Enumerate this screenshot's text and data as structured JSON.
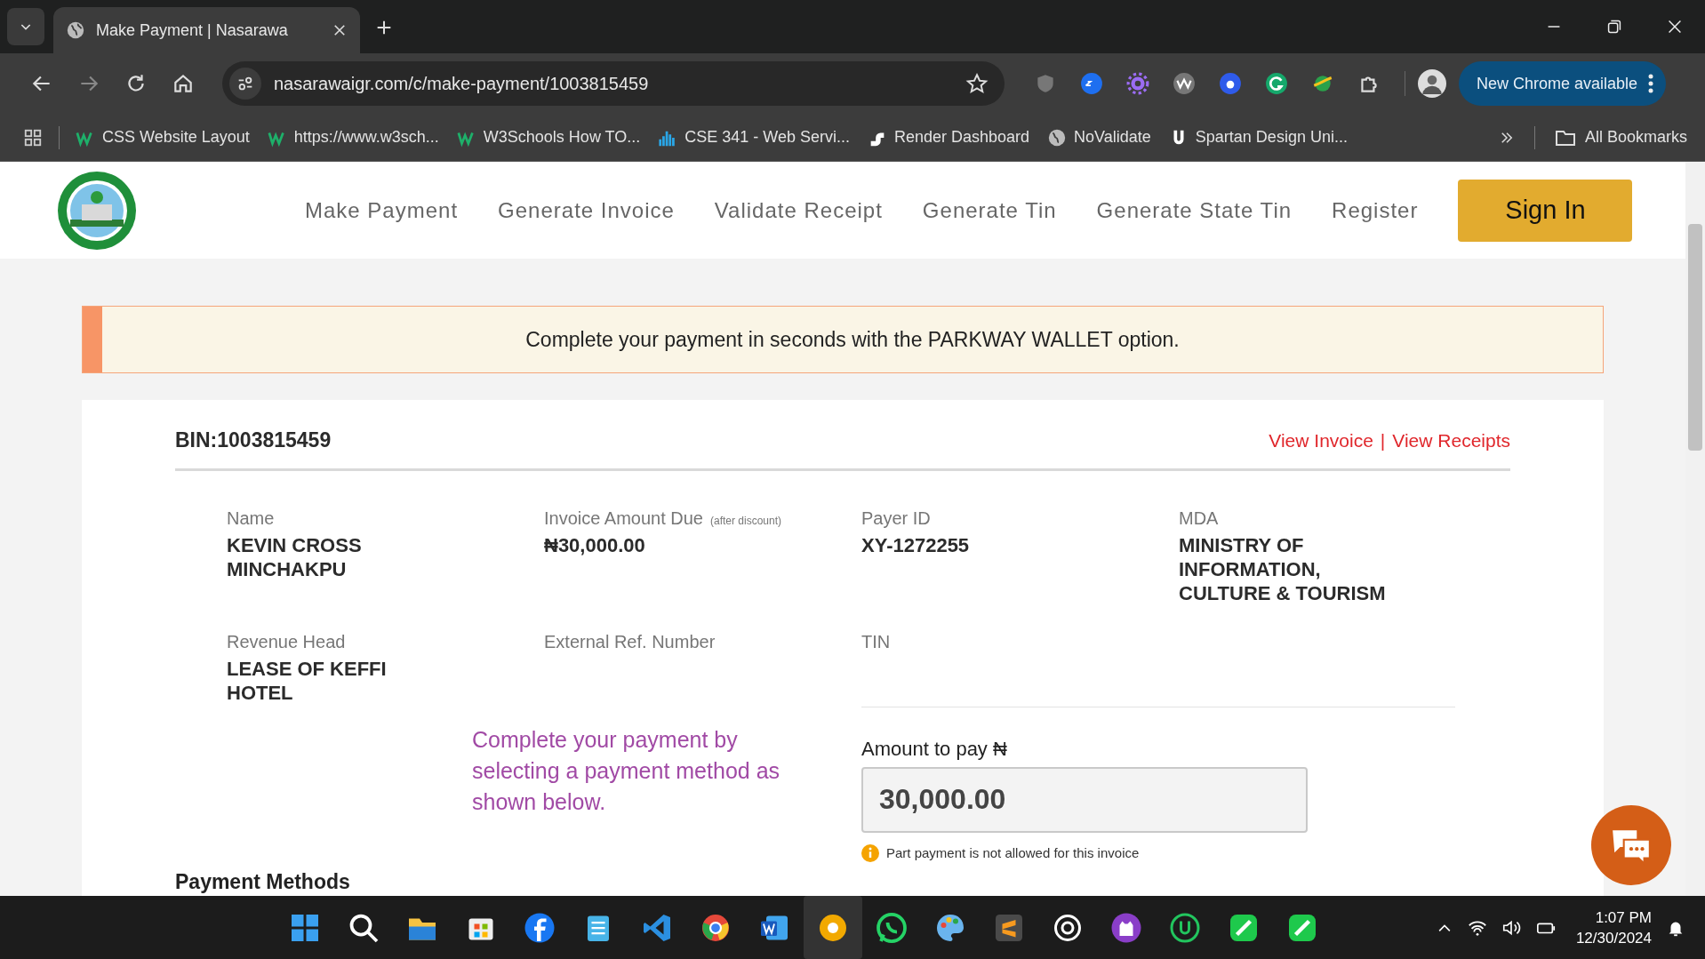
{
  "browser": {
    "tabs": [
      {
        "title": "Make Payment | Nasarawa",
        "selected": true
      }
    ],
    "url": "nasarawaigr.com/c/make-payment/1003815459",
    "update_button": "New Chrome available",
    "bookmarks": [
      {
        "label": "CSS Website Layout",
        "kind": "w3"
      },
      {
        "label": "https://www.w3sch...",
        "kind": "w3"
      },
      {
        "label": "W3Schools How TO...",
        "kind": "w3"
      },
      {
        "label": "CSE 341 - Web Servi...",
        "kind": "bars"
      },
      {
        "label": "Render Dashboard",
        "kind": "render"
      },
      {
        "label": "NoValidate",
        "kind": "globe"
      },
      {
        "label": "Spartan Design Uni...",
        "kind": "u"
      }
    ],
    "all_bookmarks": "All Bookmarks"
  },
  "site": {
    "nav": [
      "Make Payment",
      "Generate Invoice",
      "Validate Receipt",
      "Generate Tin",
      "Generate State Tin",
      "Register"
    ],
    "sign_in": "Sign In",
    "banner": "Complete your payment in seconds with the PARKWAY WALLET option.",
    "bin": "BIN:1003815459",
    "links": [
      "View Invoice",
      "View Receipts"
    ],
    "link_separator": "|",
    "fields": [
      {
        "label": "Name",
        "value": "KEVIN CROSS MINCHAKPU"
      },
      {
        "label": "Invoice Amount Due",
        "note": "(after discount)",
        "value": "₦30,000.00"
      },
      {
        "label": "Payer ID",
        "value": "XY-1272255"
      },
      {
        "label": "MDA",
        "value": "MINISTRY OF INFORMATION, CULTURE & TOURISM"
      },
      {
        "label": "Revenue Head",
        "value": "LEASE OF KEFFI HOTEL"
      },
      {
        "label": "External Ref. Number"
      },
      {
        "label": "TIN"
      }
    ],
    "prompt": "Complete your payment by selecting a payment method as shown below.",
    "amount_label": "Amount to pay ₦",
    "amount": "30,000.00",
    "amount_note": "Part payment is not allowed for this invoice",
    "section_heading": "Payment Methods"
  },
  "taskbar": {
    "time": "1:07 PM",
    "date": "12/30/2024"
  }
}
